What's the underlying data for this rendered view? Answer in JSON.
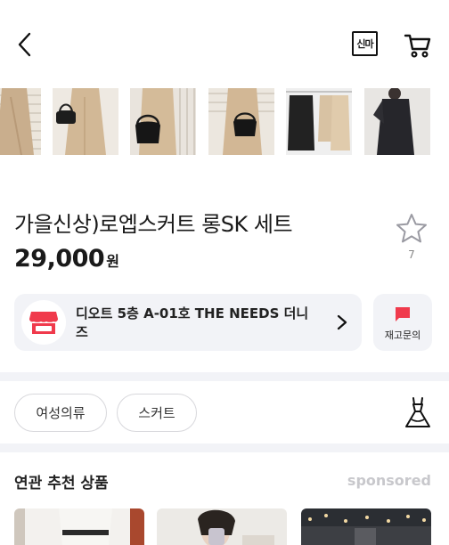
{
  "header": {
    "back_icon": "chevron-left-icon",
    "shinma_label": "신마",
    "cart_icon": "cart-icon"
  },
  "gallery": {
    "thumbnails": [
      {
        "desc": "beige-dress-crop"
      },
      {
        "desc": "beige-set-black-bag"
      },
      {
        "desc": "black-bag-closeup"
      },
      {
        "desc": "beige-set-black-bag-2"
      },
      {
        "desc": "black-and-beige-sets"
      },
      {
        "desc": "black-set"
      }
    ]
  },
  "product": {
    "title": "가을신상)로엡스커트 롱SK 세트",
    "price": "29,000",
    "currency_unit": "원",
    "favorite_count": "7"
  },
  "store": {
    "name": "디오트 5층 A-01호 THE NEEDS 더니즈",
    "chevron_icon": "chevron-right-icon",
    "store_icon": "storefront-icon"
  },
  "stock_inquiry": {
    "label": "재고문의",
    "icon": "flag-icon"
  },
  "categories": {
    "chips": [
      "여성의류",
      "스커트"
    ],
    "category_icon": "dress-icon"
  },
  "recommendations": {
    "title": "연관 추천 상품",
    "sponsored": "sponsored"
  },
  "colors": {
    "accent_red": "#f03a4c",
    "card_bg": "#f2f3f7",
    "muted": "#c8c8cc"
  }
}
